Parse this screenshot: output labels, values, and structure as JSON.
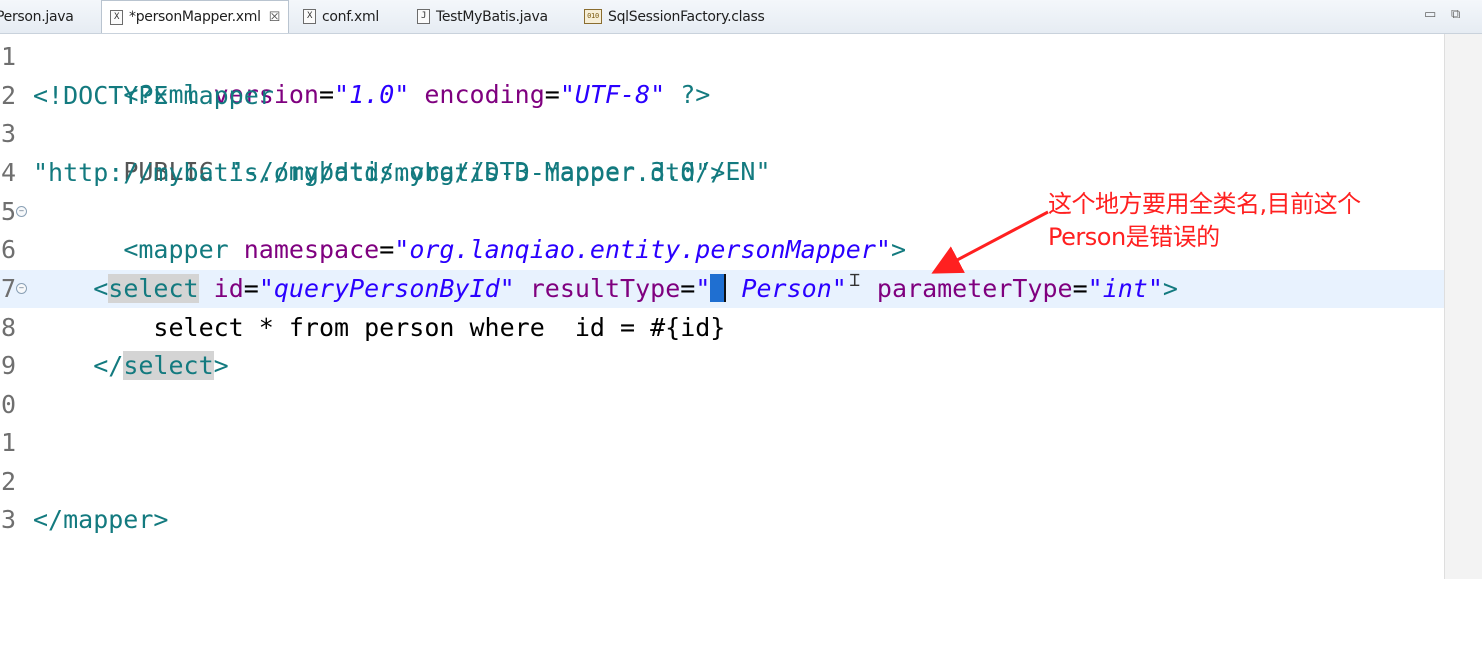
{
  "tabs": [
    {
      "label": "Person.java",
      "icon": "java-file-icon",
      "active": false
    },
    {
      "label": "*personMapper.xml",
      "icon": "xml-file-icon",
      "active": true
    },
    {
      "label": "conf.xml",
      "icon": "xml-file-icon",
      "active": false
    },
    {
      "label": "TestMyBatis.java",
      "icon": "java-file-icon",
      "active": false
    },
    {
      "label": "SqlSessionFactory.class",
      "icon": "class-file-icon",
      "active": false
    }
  ],
  "window_controls": {
    "minimize": "▭",
    "maximize": "⧉"
  },
  "editor": {
    "line_numbers": [
      "1",
      "2",
      "3",
      "4",
      "5",
      "6",
      "7",
      "8",
      "9",
      "0",
      "1",
      "2",
      "3"
    ],
    "line1": {
      "open": "<?xml ",
      "attr1": "version",
      "eq1": "=",
      "val1": "\"1.0\"",
      "attr2": " encoding",
      "eq2": "=",
      "val2": "\"UTF-8\"",
      "close": " ?>"
    },
    "line2": {
      "text": "<!DOCTYPE mapper"
    },
    "line3": {
      "kw": "PUBLIC ",
      "str": "\"-//mybatis.org//DTD Mapper 3.0//EN\""
    },
    "line4": {
      "str": "\"http://mybatis.org/dtd/mybatis-3-mapper.dtd\">"
    },
    "line5": {
      "open": "<mapper ",
      "attr": "namespace",
      "eq": "=",
      "val": "\"org.lanqiao.entity.personMapper\"",
      "close": ">"
    },
    "line7": {
      "indent": "    ",
      "lt": "<",
      "tag": "select",
      "attr1": " id",
      "eq1": "=",
      "val1": "\"queryPersonById\"",
      "attr2": " resultType",
      "eq2": "=",
      "val2a": "\"",
      "val2b": "Person\"",
      "attr3": "  parameterType",
      "eq3": "=",
      "val3": "\"int\"",
      "gt": ">"
    },
    "line8": {
      "text": "        select * from person where  id = #{id}"
    },
    "line9": {
      "indent": "    ",
      "lt": "</",
      "tag": "select",
      "gt": ">"
    },
    "line13": {
      "text": "</mapper>"
    }
  },
  "annotation": {
    "line1": "这个地方要用全类名,目前这个",
    "line2": "Person是错误的",
    "color": "#ff2020"
  }
}
